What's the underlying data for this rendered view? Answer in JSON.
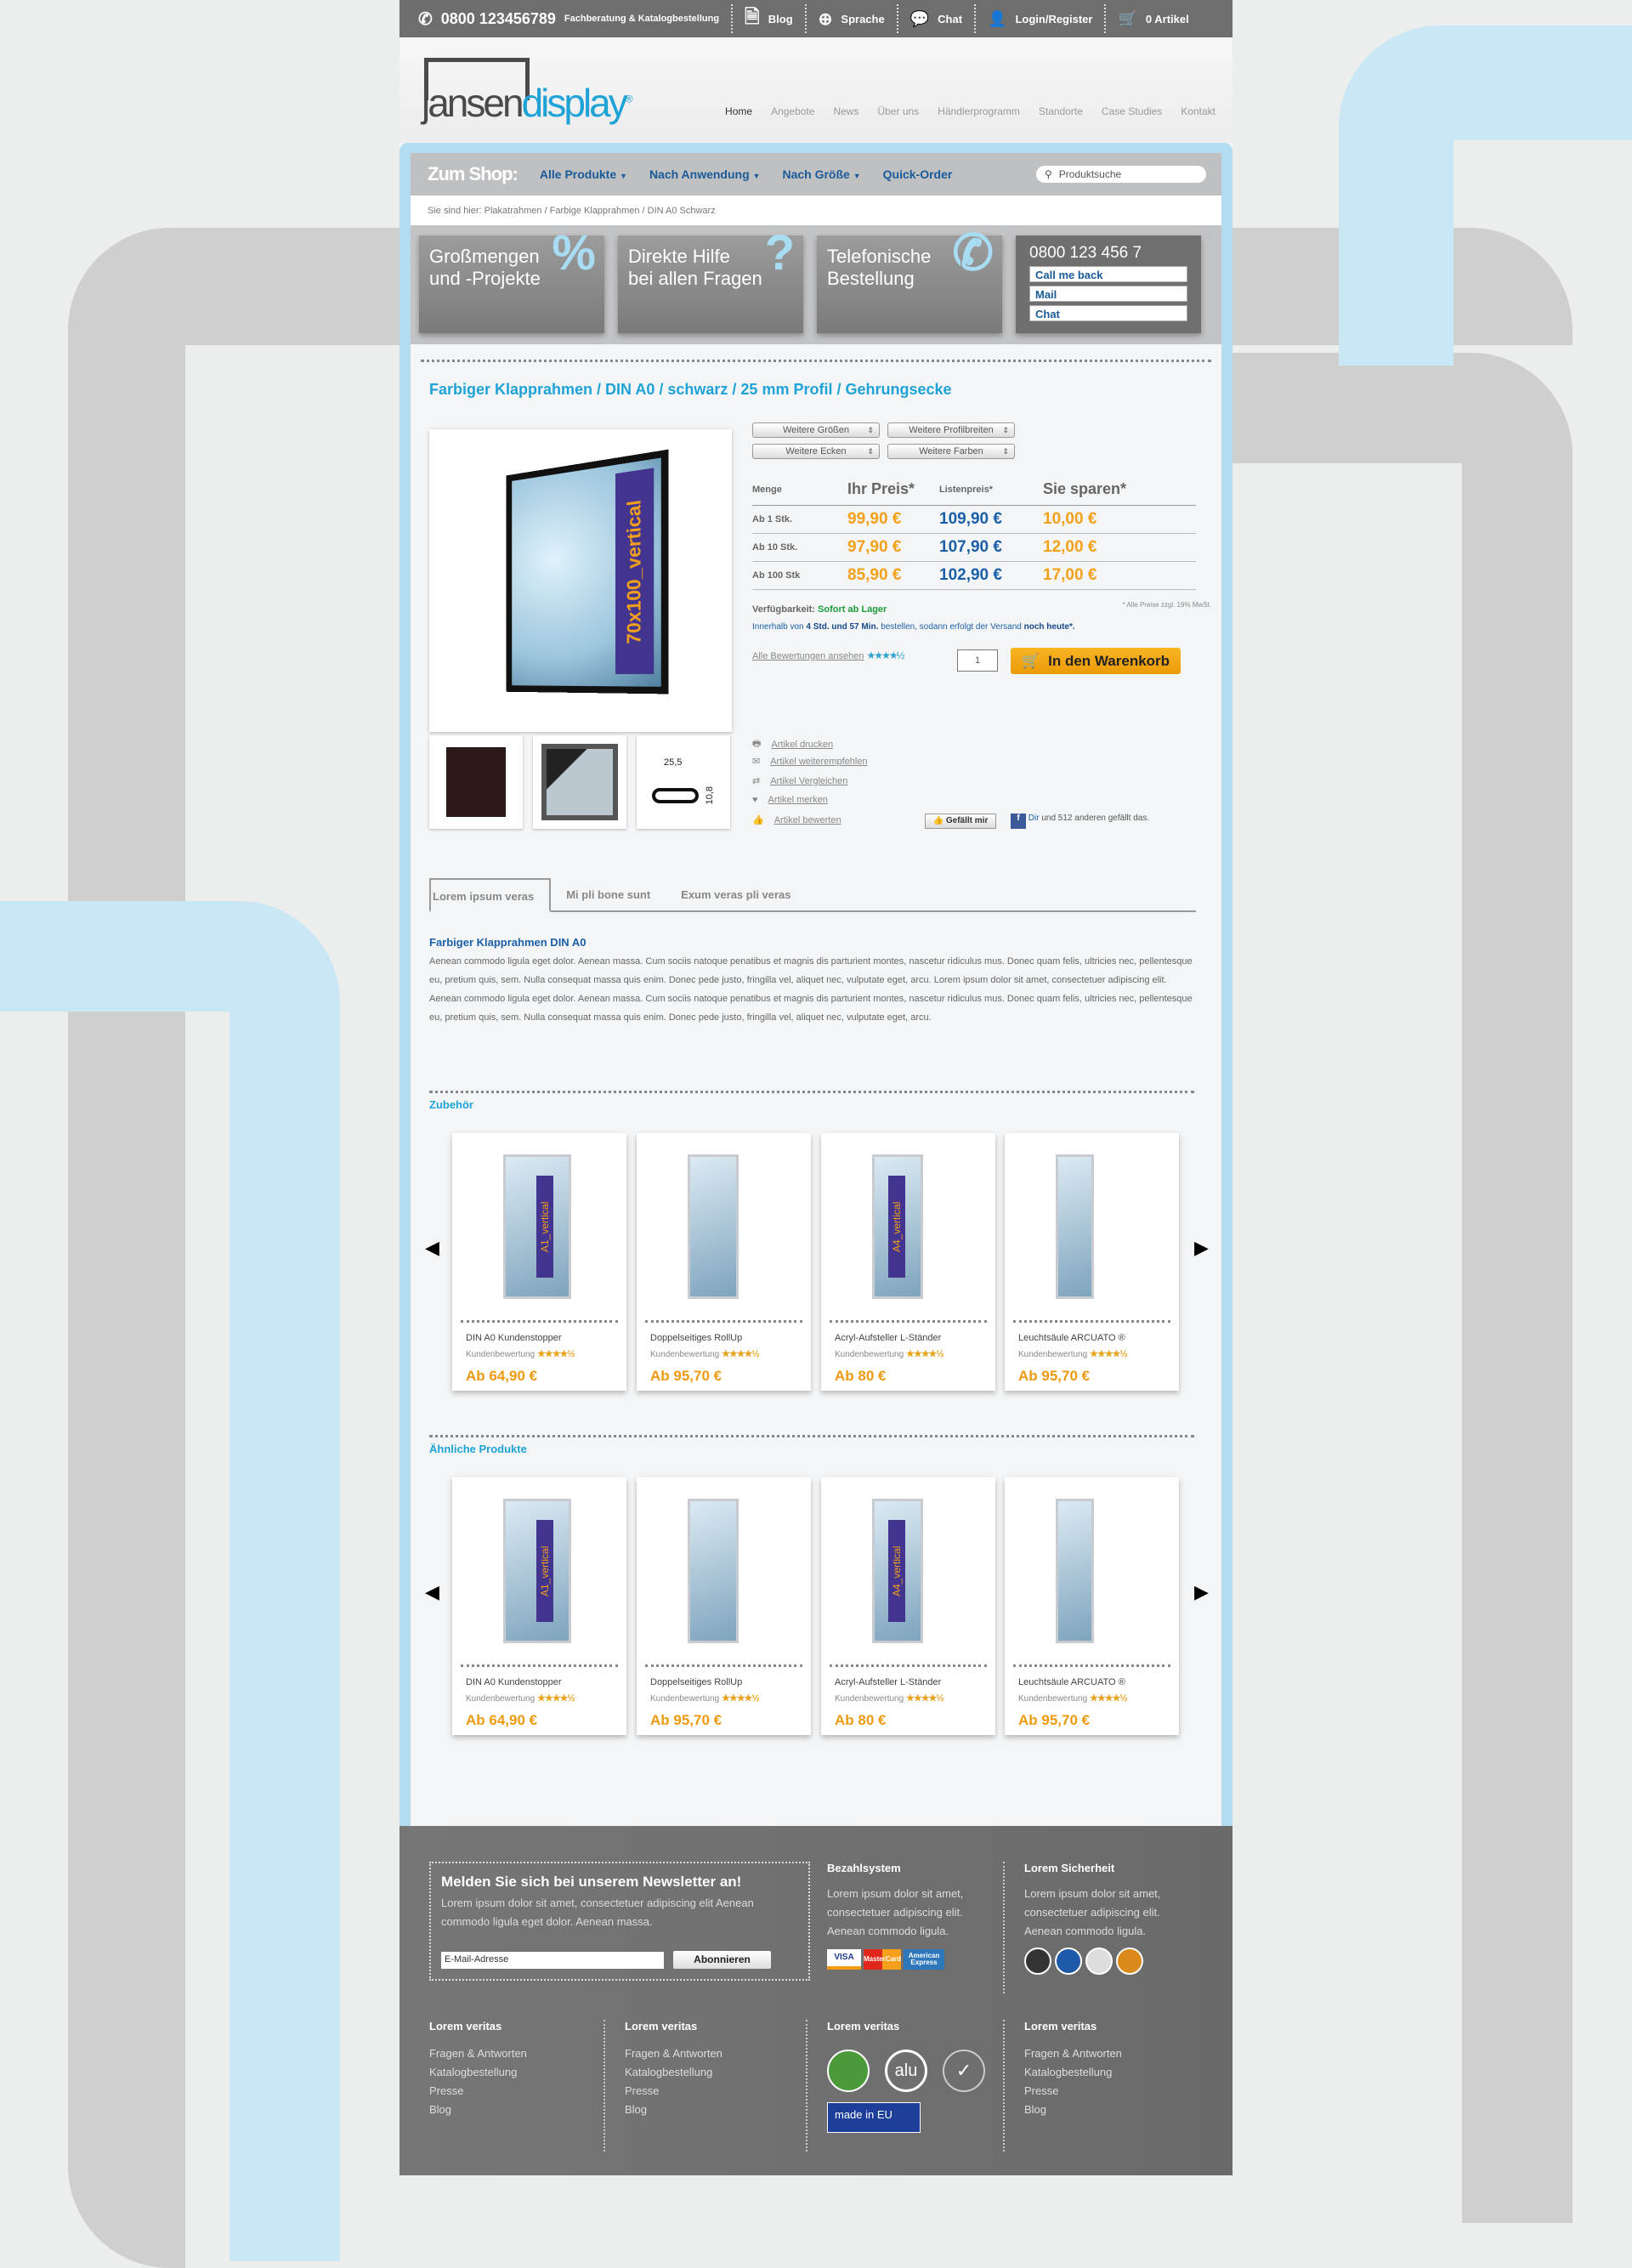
{
  "topbar": {
    "phone": "0800 123456789",
    "phone_note": "Fachberatung & Katalogbestellung",
    "blog": "Blog",
    "language": "Sprache",
    "chat": "Chat",
    "login": "Login/Register",
    "cart": "0 Artikel"
  },
  "logo": {
    "text_dark": "jansen",
    "text_blue": "display",
    "reg": "®"
  },
  "mainnav": [
    "Home",
    "Angebote",
    "News",
    "Über uns",
    "Händlerprogramm",
    "Standorte",
    "Case Studies",
    "Kontakt"
  ],
  "shopbar": {
    "title": "Zum Shop:",
    "items": [
      "Alle Produkte",
      "Nach Anwendung",
      "Nach Größe",
      "Quick-Order"
    ],
    "search_placeholder": "Produktsuche"
  },
  "breadcrumb": "Sie sind hier: Plakatrahmen / Farbige Klapprahmen / DIN A0 Schwarz",
  "features": [
    {
      "l1": "Großmengen",
      "l2": "und -Projekte",
      "sym": "%"
    },
    {
      "l1": "Direkte Hilfe",
      "l2": "bei allen Fragen",
      "sym": "?"
    },
    {
      "l1": "Telefonische",
      "l2": "Bestellung",
      "sym": "✆"
    }
  ],
  "contact": {
    "phone": "0800 123 456 7",
    "buttons": [
      "Call me back",
      "Mail",
      "Chat"
    ]
  },
  "product": {
    "title": "Farbiger Klapprahmen / DIN A0 / schwarz / 25 mm Profil / Gehrungsecke",
    "image_label": "70x100_vertical",
    "thumb_dims": [
      "25,5",
      "10,8"
    ],
    "selects": [
      "Weitere Größen",
      "Weitere Profilbreiten",
      "Weitere Ecken",
      "Weitere Farben"
    ],
    "price_headers": [
      "Menge",
      "Ihr Preis*",
      "Listenpreis*",
      "Sie sparen*"
    ],
    "prices": [
      [
        "Ab 1 Stk.",
        "99,90 €",
        "109,90 €",
        "10,00 €"
      ],
      [
        "Ab 10 Stk.",
        "97,90 €",
        "107,90 €",
        "12,00 €"
      ],
      [
        "Ab 100 Stk",
        "85,90 €",
        "102,90 €",
        "17,00 €"
      ]
    ],
    "vat_note": "* Alle Preise zzgl. 19% MwSt.",
    "availability_label": "Verfügbarkeit:",
    "availability": "Sofort ab Lager",
    "ship_a": "Innerhalb von",
    "ship_b": "4 Std. und 57 Min.",
    "ship_c": "bestellen, sodann erfolgt der Versand",
    "ship_d": "noch heute*.",
    "reviews_link": "Alle Bewertungen ansehen",
    "rating": 4.5,
    "quantity": "1",
    "cart_button": "In den Warenkorb",
    "actions": [
      "Artikel drucken",
      "Artikel weiterempfehlen",
      "Artikel Vergleichen",
      "Artikel merken",
      "Artikel bewerten"
    ],
    "like_button": "Gefällt mir",
    "fb_you": "Dir",
    "fb_text": "und 512 anderen gefällt das."
  },
  "tabs": [
    "Lorem ipsum veras",
    "Mi pli bone sunt",
    "Exum veras pli veras"
  ],
  "description": {
    "heading": "Farbiger Klapprahmen DIN A0",
    "text": "Aenean commodo ligula eget dolor. Aenean massa. Cum sociis natoque penatibus et magnis dis parturient montes, nascetur ridiculus mus. Donec quam felis, ultricies nec, pellentesque eu, pretium quis, sem. Nulla consequat massa quis enim. Donec pede justo, fringilla vel, aliquet nec, vulputate eget, arcu. Lorem ipsum dolor sit amet, consectetuer adipiscing elit. Aenean commodo ligula eget dolor. Aenean massa. Cum sociis natoque penatibus et magnis dis parturient montes, nascetur ridiculus mus. Donec quam felis, ultricies nec, pellentesque eu, pretium quis, sem. Nulla consequat massa quis enim. Donec pede justo, fringilla vel, aliquet nec, vulputate eget, arcu."
  },
  "sections": [
    {
      "title": "Zubehör",
      "cards": [
        {
          "name": "DIN A0 Kundenstopper",
          "rating_label": "Kundenbewertung",
          "price": "Ab 64,90 €",
          "img_label": "A1_vertical"
        },
        {
          "name": "Doppelseitiges RollUp",
          "rating_label": "Kundenbewertung",
          "price": "Ab 95,70 €",
          "img_label": ""
        },
        {
          "name": "Acryl-Aufsteller L-Ständer",
          "rating_label": "Kundenbewertung",
          "price": "Ab 80 €",
          "img_label": "A4_vertical"
        },
        {
          "name": "Leuchtsäule ARCUATO ®",
          "rating_label": "Kundenbewertung",
          "price": "Ab 95,70 €",
          "img_label": ""
        }
      ]
    },
    {
      "title": "Ähnliche Produkte",
      "cards": [
        {
          "name": "DIN A0 Kundenstopper",
          "rating_label": "Kundenbewertung",
          "price": "Ab 64,90 €",
          "img_label": "A1_vertical"
        },
        {
          "name": "Doppelseitiges RollUp",
          "rating_label": "Kundenbewertung",
          "price": "Ab 95,70 €",
          "img_label": ""
        },
        {
          "name": "Acryl-Aufsteller L-Ständer",
          "rating_label": "Kundenbewertung",
          "price": "Ab 80 €",
          "img_label": "A4_vertical"
        },
        {
          "name": "Leuchtsäule ARCUATO ®",
          "rating_label": "Kundenbewertung",
          "price": "Ab 95,70 €",
          "img_label": ""
        }
      ]
    }
  ],
  "footer": {
    "newsletter_title": "Melden Sie sich bei unserem Newsletter an!",
    "newsletter_text": "Lorem ipsum dolor sit amet, consectetuer adipiscing elit Aenean commodo ligula eget dolor. Aenean massa.",
    "email_placeholder": "E-Mail-Adresse",
    "subscribe": "Abonnieren",
    "payment_title": "Bezahlsystem",
    "payment_text": "Lorem ipsum dolor sit amet, consectetuer adipiscing elit. Aenean commodo ligula.",
    "payment_logos": [
      "VISA",
      "MasterCard",
      "American Express"
    ],
    "security_title": "Lorem Sicherheit",
    "security_text": "Lorem ipsum dolor sit amet, consectetuer adipiscing elit. Aenean commodo ligula.",
    "col_title": "Lorem veritas",
    "links": [
      "Fragen & Antworten",
      "Katalogbestellung",
      "Presse",
      "Blog"
    ],
    "made_in": "made in EU",
    "alu": "alu"
  },
  "colors": {
    "accent_blue": "#1fa3d6",
    "link_blue": "#1a5a98",
    "price_orange": "#f3a01b",
    "frame_blue": "#b3dcf0",
    "footer_gray": "#6f6f6f"
  }
}
